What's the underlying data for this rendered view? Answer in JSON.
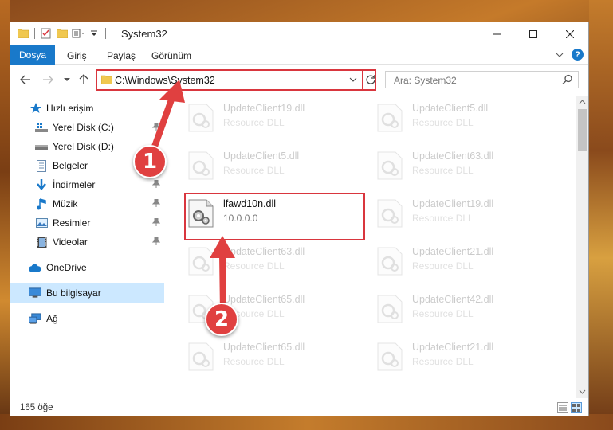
{
  "window": {
    "title": "System32"
  },
  "ribbon": {
    "tabs": [
      "Dosya",
      "Giriş",
      "Paylaş",
      "Görünüm"
    ],
    "help_label": "?"
  },
  "address": {
    "path": "C:\\Windows\\System32"
  },
  "search": {
    "placeholder": "Ara: System32"
  },
  "sidebar": {
    "items": [
      {
        "label": "Hızlı erişim",
        "icon": "star-icon"
      },
      {
        "label": "Yerel Disk (C:)",
        "icon": "drive-c-icon"
      },
      {
        "label": "Yerel Disk (D:)",
        "icon": "drive-d-icon"
      },
      {
        "label": "Belgeler",
        "icon": "documents-icon"
      },
      {
        "label": "İndirmeler",
        "icon": "download-icon"
      },
      {
        "label": "Müzik",
        "icon": "music-icon"
      },
      {
        "label": "Resimler",
        "icon": "pictures-icon"
      },
      {
        "label": "Videolar",
        "icon": "videos-icon"
      },
      {
        "label": "OneDrive",
        "icon": "cloud-icon"
      },
      {
        "label": "Bu bilgisayar",
        "icon": "computer-icon"
      },
      {
        "label": "Ağ",
        "icon": "network-icon"
      }
    ]
  },
  "files": {
    "left": [
      {
        "name": "UpdateClient19.dll",
        "desc": "Resource DLL"
      },
      {
        "name": "UpdateClient5.dll",
        "desc": "Resource DLL"
      },
      {
        "name": "lfawd10n.dll",
        "desc": "10.0.0.0"
      },
      {
        "name": "UpdateClient63.dll",
        "desc": "Resource DLL"
      },
      {
        "name": "UpdateClient65.dll",
        "desc": "Resource DLL"
      },
      {
        "name": "UpdateClient65.dll",
        "desc": "Resource DLL"
      }
    ],
    "right": [
      {
        "name": "UpdateClient5.dll",
        "desc": "Resource DLL"
      },
      {
        "name": "UpdateClient63.dll",
        "desc": "Resource DLL"
      },
      {
        "name": "UpdateClient19.dll",
        "desc": "Resource DLL"
      },
      {
        "name": "UpdateClient21.dll",
        "desc": "Resource DLL"
      },
      {
        "name": "UpdateClient42.dll",
        "desc": "Resource DLL"
      },
      {
        "name": "UpdateClient21.dll",
        "desc": "Resource DLL"
      }
    ]
  },
  "status": {
    "count": "165 öğe"
  },
  "annotations": {
    "step1": "1",
    "step2": "2"
  },
  "colors": {
    "accent": "#1979ca",
    "highlight": "#d9363e",
    "selected": "#cce8ff"
  }
}
